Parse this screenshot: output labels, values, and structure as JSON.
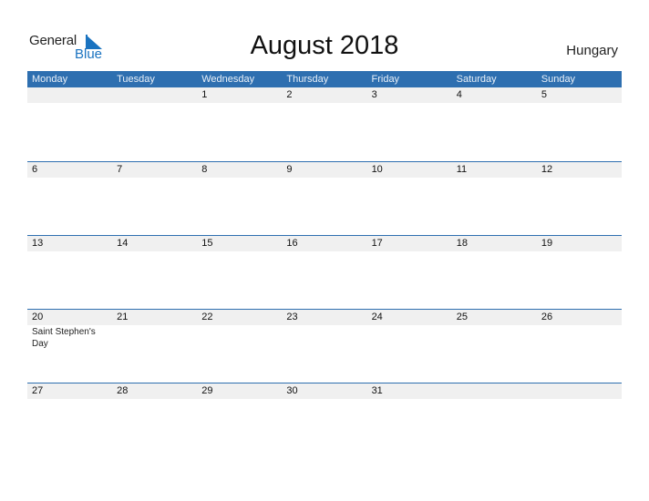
{
  "logo": {
    "word1": "General",
    "word2": "Blue"
  },
  "title": "August 2018",
  "country": "Hungary",
  "colors": {
    "accent": "#2e6fb0",
    "band": "#f0f0f0",
    "logo_blue": "#1a73c0"
  },
  "weekdays": [
    "Monday",
    "Tuesday",
    "Wednesday",
    "Thursday",
    "Friday",
    "Saturday",
    "Sunday"
  ],
  "weeks": [
    {
      "days": [
        {
          "num": "",
          "event": ""
        },
        {
          "num": "",
          "event": ""
        },
        {
          "num": "1",
          "event": ""
        },
        {
          "num": "2",
          "event": ""
        },
        {
          "num": "3",
          "event": ""
        },
        {
          "num": "4",
          "event": ""
        },
        {
          "num": "5",
          "event": ""
        }
      ]
    },
    {
      "days": [
        {
          "num": "6",
          "event": ""
        },
        {
          "num": "7",
          "event": ""
        },
        {
          "num": "8",
          "event": ""
        },
        {
          "num": "9",
          "event": ""
        },
        {
          "num": "10",
          "event": ""
        },
        {
          "num": "11",
          "event": ""
        },
        {
          "num": "12",
          "event": ""
        }
      ]
    },
    {
      "days": [
        {
          "num": "13",
          "event": ""
        },
        {
          "num": "14",
          "event": ""
        },
        {
          "num": "15",
          "event": ""
        },
        {
          "num": "16",
          "event": ""
        },
        {
          "num": "17",
          "event": ""
        },
        {
          "num": "18",
          "event": ""
        },
        {
          "num": "19",
          "event": ""
        }
      ]
    },
    {
      "days": [
        {
          "num": "20",
          "event": "Saint Stephen's Day"
        },
        {
          "num": "21",
          "event": ""
        },
        {
          "num": "22",
          "event": ""
        },
        {
          "num": "23",
          "event": ""
        },
        {
          "num": "24",
          "event": ""
        },
        {
          "num": "25",
          "event": ""
        },
        {
          "num": "26",
          "event": ""
        }
      ]
    },
    {
      "days": [
        {
          "num": "27",
          "event": ""
        },
        {
          "num": "28",
          "event": ""
        },
        {
          "num": "29",
          "event": ""
        },
        {
          "num": "30",
          "event": ""
        },
        {
          "num": "31",
          "event": ""
        },
        {
          "num": "",
          "event": ""
        },
        {
          "num": "",
          "event": ""
        }
      ]
    }
  ]
}
